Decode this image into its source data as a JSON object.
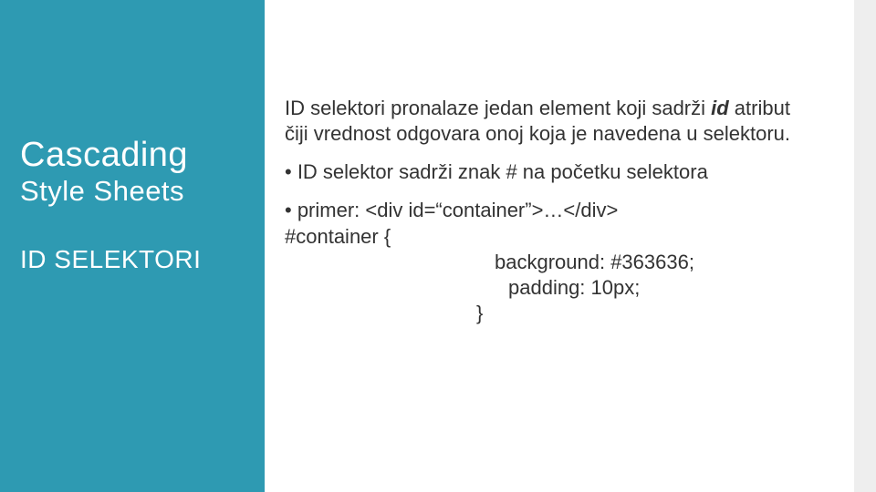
{
  "sidebar": {
    "title_line1": "Cascading",
    "title_line2": "Style  Sheets",
    "subtitle": "ID SELEKTORI"
  },
  "content": {
    "p1_a": "ID selektori pronalaze jedan element koji sadrži ",
    "p1_id": "id",
    "p1_b": " atribut čiji vrednost odgovara onoj koja je navedena u selektoru.",
    "p2": "• ID selektor sadrži znak # na početku selektora",
    "p3_a": "• primer: <div id=“container”>…</div>",
    "p3_b": " #container {",
    "p3_c": "background: #363636;",
    "p3_d": "padding: 10px;",
    "p3_e": "}"
  }
}
